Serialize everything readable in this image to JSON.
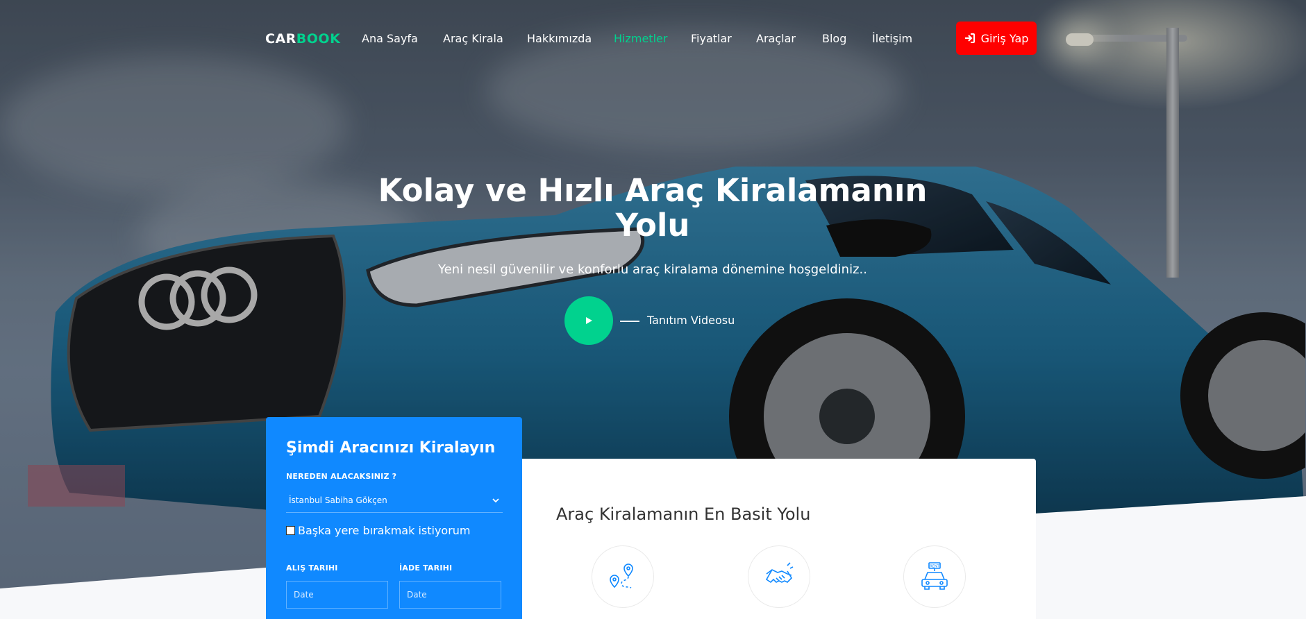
{
  "brand": {
    "part1": "CAR",
    "part2": "BOOK",
    "accent": "#01d28e"
  },
  "nav": {
    "items": [
      {
        "label": "Ana Sayfa"
      },
      {
        "label": "Araç Kirala"
      },
      {
        "label": "Hakkımızda"
      },
      {
        "label": "Hizmetler",
        "active": true
      },
      {
        "label": "Fiyatlar"
      },
      {
        "label": "Araçlar"
      },
      {
        "label": "Blog"
      },
      {
        "label": "İletişim"
      }
    ],
    "login_label": "Giriş Yap",
    "login_color": "#ff0000"
  },
  "hero": {
    "title_line1": "Kolay ve Hızlı Araç Kiralamanın",
    "title_line2": "Yolu",
    "subtitle": "Yeni nesil güvenilir ve konforlu araç kiralama dönemine hoşgeldiniz..",
    "video_label": "Tanıtım Videosu"
  },
  "booking": {
    "title": "Şimdi Aracınızı Kiralayın",
    "pickup_label": "NEREDEN ALACAKSINIZ ?",
    "pickup_value": "İstanbul Sabiha Gökçen",
    "dropoff_checkbox_label": "Başka yere bırakmak istiyorum",
    "pickup_date_label": "ALIŞ TARIHI",
    "return_date_label": "İADE TARIHI",
    "pickup_date_placeholder": "Date",
    "return_date_placeholder": "Date",
    "color": "#1089ff"
  },
  "services": {
    "title": "Araç Kiralamanın En Basit Yolu",
    "icons": [
      "location-route-icon",
      "handshake-icon",
      "rent-car-icon"
    ]
  }
}
